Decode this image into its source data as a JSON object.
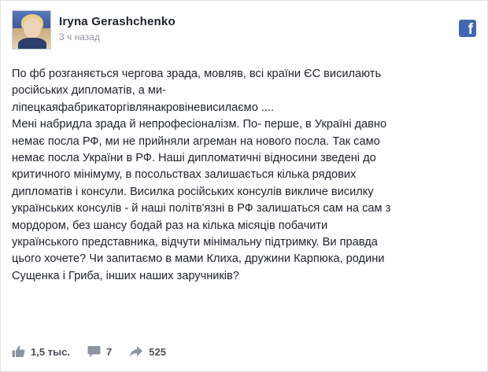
{
  "post": {
    "author": "Iryna Gerashchenko",
    "time": "3 ч назад",
    "lines": [
      "По фб розганяється чергова зрада, мовляв, всі країни ЄС висилають",
      "російських дипломатів, а ми-",
      "ліпецкаяфабрикаторгівлянакровіневисилаємо ....",
      "Мені набридла зрада й непрофесіоналізм. По- перше, в Україні давно",
      "немає посла РФ, ми не прийняли агреман на нового посла. Так само",
      "немає посла України в РФ. Наші дипломатичні відносини зведені до",
      "критичного мінімуму, в посольствах залишається кілька рядових",
      "дипломатів і консули. Висилка російських консулів викличе висилку",
      "українських консулів - й наші політв'язні в РФ залишаться сам на сам з",
      "мордором, без шансу бодай раз на кілька місяців побачити",
      "українського представника, відчути мінімальну підтримку. Ви правда",
      "цього хочете? Чи запитаємо в мами Клиха, дружини Карпюка, родини",
      "Сущенка і Гриба, інших наших заручників?"
    ]
  },
  "footer": {
    "likes": "1,5 тыс.",
    "comments": "7",
    "shares": "525"
  },
  "icons": {
    "brand": "facebook-logo-icon",
    "like": "thumbs-up-icon",
    "comment": "comment-icon",
    "share": "share-icon"
  },
  "colors": {
    "brand": "#4267b2",
    "text": "#1d2129",
    "muted": "#90949c"
  }
}
